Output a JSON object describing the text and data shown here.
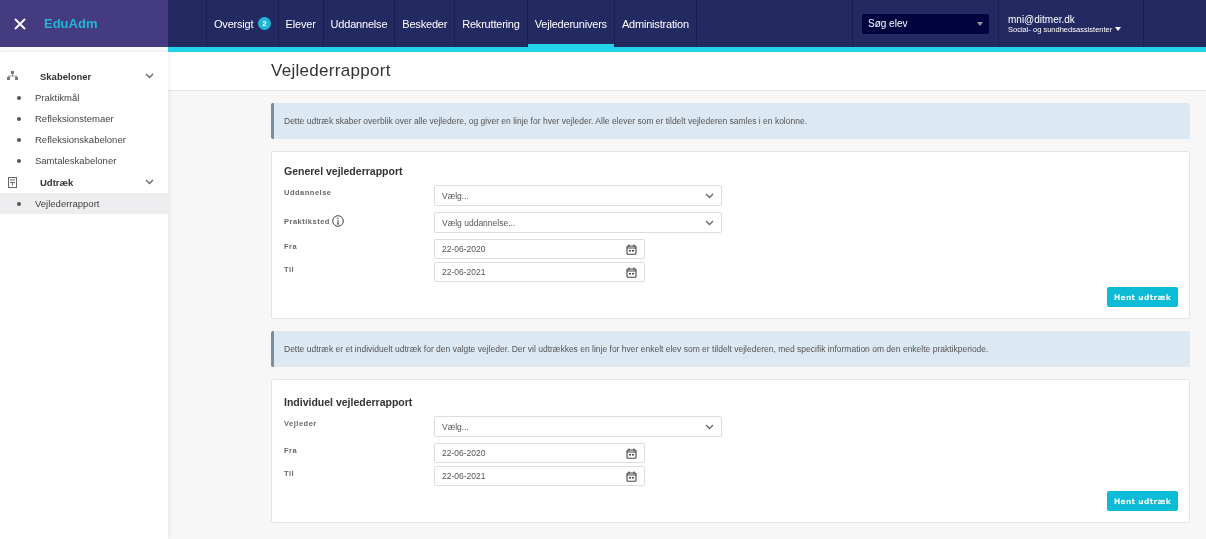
{
  "app": {
    "title": "EduAdm"
  },
  "nav": [
    {
      "label": "Oversigt",
      "badge": "2",
      "selected": false
    },
    {
      "label": "Elever",
      "selected": false
    },
    {
      "label": "Uddannelse",
      "selected": false
    },
    {
      "label": "Beskeder",
      "selected": false
    },
    {
      "label": "Rekruttering",
      "selected": false
    },
    {
      "label": "Vejlederunivers",
      "selected": true
    },
    {
      "label": "Administration",
      "selected": false
    }
  ],
  "search": {
    "placeholder": "Søg elev"
  },
  "user": {
    "email": "mni@ditmer.dk",
    "role": "Social- og sundhedsassistenter"
  },
  "sidebar": {
    "groups": [
      {
        "label": "Skabeloner",
        "expanded": true,
        "items": [
          {
            "label": "Praktikmål",
            "selected": false
          },
          {
            "label": "Refleksionstemaer",
            "selected": false
          },
          {
            "label": "Refleksionskabeloner",
            "selected": false
          },
          {
            "label": "Samtaleskabeloner",
            "selected": false
          }
        ]
      },
      {
        "label": "Udtræk",
        "expanded": true,
        "items": [
          {
            "label": "Vejlederrapport",
            "selected": true
          }
        ]
      }
    ]
  },
  "page_title": "Vejlederrapport",
  "sections": [
    {
      "info": "Dette udtræk skaber overblik over alle vejledere, og giver en linje for hver vejleder. Alle elever som er tildelt vejlederen samles i en kolonne.",
      "title": "Generel vejlederrapport",
      "fields": [
        {
          "kind": "select",
          "label": "Uddannelse",
          "value": "Vælg..."
        },
        {
          "kind": "select",
          "label": "Praktiksted",
          "value": "Vælg uddannelse...",
          "info_icon": true
        },
        {
          "kind": "date",
          "label": "Fra",
          "value": "22-06-2020"
        },
        {
          "kind": "date",
          "label": "Til",
          "value": "22-06-2021"
        }
      ],
      "button": "Hent udtræk"
    },
    {
      "info": "Dette udtræk er et individuelt udtræk for den valgte vejleder. Der vil udtrækkes en linje for hver enkelt elev som er tildelt vejlederen, med specifik information om den enkelte praktikperiode.",
      "title": "Individuel vejlederrapport",
      "fields": [
        {
          "kind": "select",
          "label": "Vejleder",
          "value": "Vælg..."
        },
        {
          "kind": "date",
          "label": "Fra",
          "value": "22-06-2020"
        },
        {
          "kind": "date",
          "label": "Til",
          "value": "22-06-2021"
        }
      ],
      "button": "Hent udtræk"
    }
  ]
}
